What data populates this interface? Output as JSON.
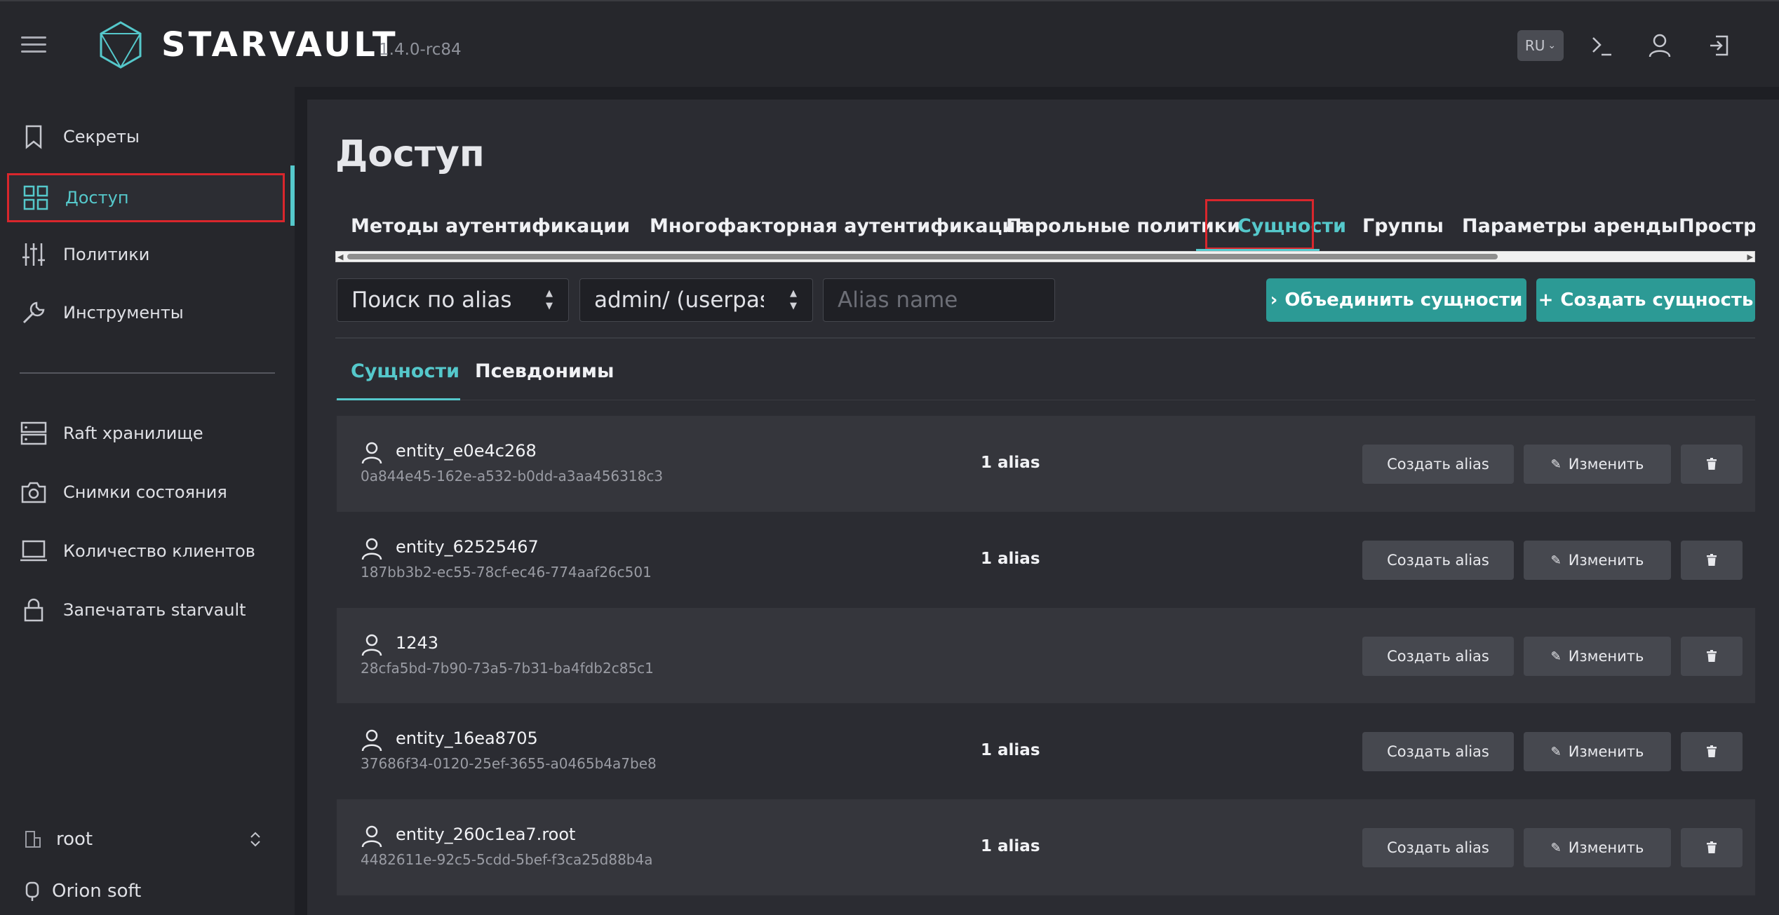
{
  "header": {
    "brand": "STARVAULT",
    "version": "1.4.0-rc84",
    "language": "RU"
  },
  "sidebar": {
    "items": [
      {
        "label": "Секреты",
        "icon": "bookmark-icon"
      },
      {
        "label": "Доступ",
        "icon": "grid-icon"
      },
      {
        "label": "Политики",
        "icon": "sliders-icon"
      },
      {
        "label": "Инструменты",
        "icon": "wrench-icon"
      },
      {
        "label": "Raft хранилище",
        "icon": "server-icon"
      },
      {
        "label": "Снимки состояния",
        "icon": "camera-icon"
      },
      {
        "label": "Количество клиентов",
        "icon": "laptop-icon"
      },
      {
        "label": "Запечатать starvault",
        "icon": "lock-icon"
      }
    ],
    "namespace": "root",
    "company": "Orion soft"
  },
  "main": {
    "title": "Доступ",
    "tabs": [
      "Методы аутентификации",
      "Многофакторная аутентификация",
      "Парольные политики",
      "Сущности",
      "Группы",
      "Параметры аренды",
      "Пространст"
    ],
    "active_tab": "Сущности",
    "filters": {
      "search_select": "Поиск по alias r",
      "mount_select": "admin/ (userpas",
      "alias_placeholder": "Alias name"
    },
    "actions": {
      "merge": "Объединить сущности",
      "create": "Создать сущность"
    },
    "subtabs": [
      "Сущности",
      "Псевдонимы"
    ],
    "row_actions": {
      "create_alias": "Создать alias",
      "edit": "Изменить"
    },
    "entities": [
      {
        "name": "entity_e0e4c268",
        "id": "0a844e45-162e-a532-b0dd-a3aa456318c3",
        "aliases": "1 alias"
      },
      {
        "name": "entity_62525467",
        "id": "187bb3b2-ec55-78cf-ec46-774aaf26c501",
        "aliases": "1 alias"
      },
      {
        "name": "1243",
        "id": "28cfa5bd-7b90-73a5-7b31-ba4fdb2c85c1",
        "aliases": ""
      },
      {
        "name": "entity_16ea8705",
        "id": "37686f34-0120-25ef-3655-a0465b4a7be8",
        "aliases": "1 alias"
      },
      {
        "name": "entity_260c1ea7.root",
        "id": "4482611e-92c5-5cdd-5bef-f3ca25d88b4a",
        "aliases": "1 alias"
      }
    ]
  },
  "colors": {
    "accent": "#55c8cb",
    "primary_button": "#2c9a95",
    "highlight": "#d9262c"
  }
}
